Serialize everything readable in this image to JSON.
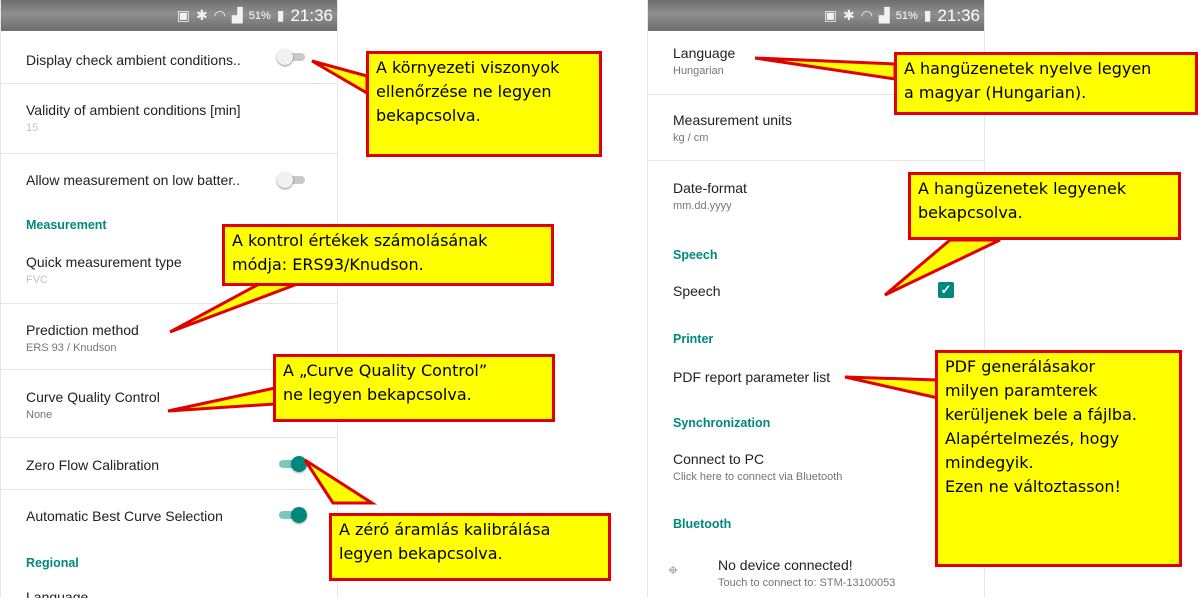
{
  "status_bar": {
    "battery": "51%",
    "time": "21:36",
    "icons": [
      "nfc-icon",
      "bluetooth-icon",
      "wifi-icon",
      "signal-icon",
      "battery-icon"
    ]
  },
  "left_screen": {
    "display_check": {
      "title": "Display check ambient conditions..",
      "enabled": false
    },
    "validity": {
      "title": "Validity of ambient conditions [min]",
      "value": "15"
    },
    "low_battery": {
      "title": "Allow measurement on low batter..",
      "enabled": false
    },
    "measurement_header": "Measurement",
    "quick_type": {
      "title": "Quick measurement type",
      "value": "FVC"
    },
    "prediction": {
      "title": "Prediction method",
      "value": "ERS 93 / Knudson"
    },
    "curve_quality": {
      "title": "Curve Quality Control",
      "value": "None"
    },
    "zero_flow": {
      "title": "Zero Flow Calibration",
      "enabled": true
    },
    "auto_best": {
      "title": "Automatic Best Curve Selection",
      "enabled": true
    },
    "regional_header": "Regional",
    "language_partial": "Language"
  },
  "right_screen": {
    "language": {
      "title": "Language",
      "value": "Hungarian"
    },
    "units": {
      "title": "Measurement units",
      "value": "kg / cm"
    },
    "date_format": {
      "title": "Date-format",
      "value": "mm.dd.yyyy"
    },
    "speech_header": "Speech",
    "speech": {
      "title": "Speech",
      "checked": true
    },
    "printer_header": "Printer",
    "pdf_list": {
      "title": "PDF report parameter list"
    },
    "sync_header": "Synchronization",
    "connect_pc": {
      "title": "Connect to PC",
      "value": "Click here to connect via Bluetooth"
    },
    "bluetooth_header": "Bluetooth",
    "device": {
      "title": "No device connected!",
      "value": "Touch to connect to: STM-13100053"
    }
  },
  "callouts": {
    "c1": [
      "A környezeti viszonyok",
      "ellenőrzése ne legyen",
      "bekapcsolva."
    ],
    "c2": [
      "A kontrol értékek számolásának",
      "módja: ERS93/Knudson."
    ],
    "c3": [
      "A „Curve Quality Control”",
      "ne legyen bekapcsolva."
    ],
    "c4": [
      "A zéró áramlás kalibrálása",
      "legyen bekapcsolva."
    ],
    "c5": [
      "A hangüzenetek nyelve legyen",
      "a magyar (Hungarian)."
    ],
    "c6": [
      "A hangüzenetek legyenek",
      "bekapcsolva."
    ],
    "c7": [
      "PDF generálásakor",
      "milyen paramterek",
      "kerüljenek bele a fájlba.",
      "Alapértelmezés, hogy",
      "mindegyik.",
      "Ezen ne változtasson!"
    ]
  },
  "colors": {
    "accent": "#00897b",
    "callout_fill": "#ffff00",
    "callout_border": "#e00000"
  }
}
